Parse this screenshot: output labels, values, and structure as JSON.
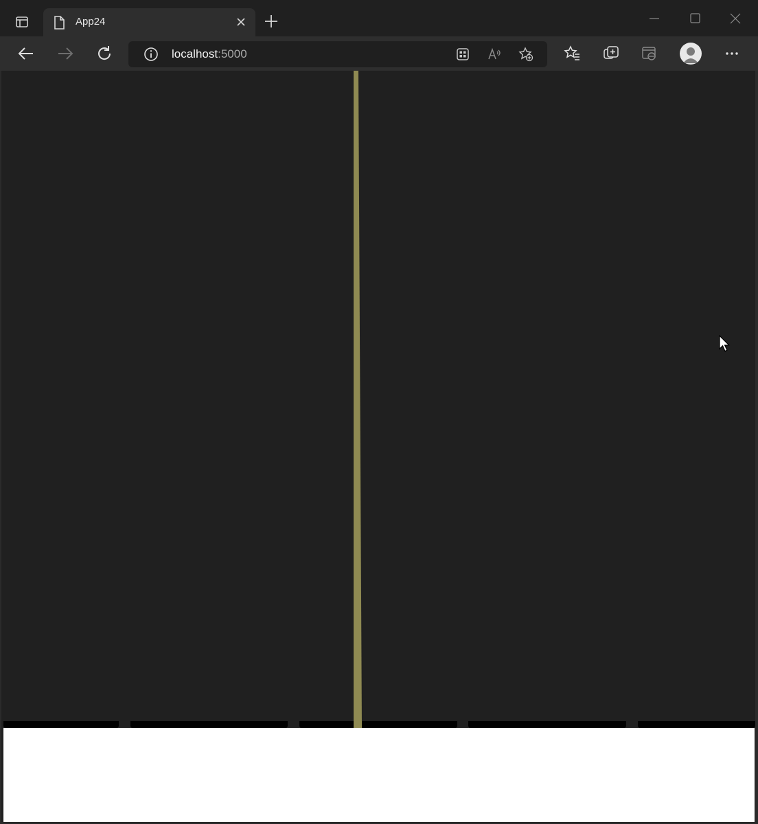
{
  "browser": {
    "tab_title": "App24",
    "url_host": "localhost",
    "url_port": ":5000"
  },
  "page": {
    "bars": [
      {
        "label": "",
        "index": 1
      },
      {
        "label": "",
        "index": 2
      },
      {
        "label": "",
        "index": 3
      },
      {
        "label": "",
        "index": 4
      },
      {
        "label": "",
        "index": 5
      }
    ]
  },
  "colors": {
    "background": "#202020",
    "pole": "#8f8a52",
    "ground": "#ffffff",
    "bar": "#000000"
  }
}
